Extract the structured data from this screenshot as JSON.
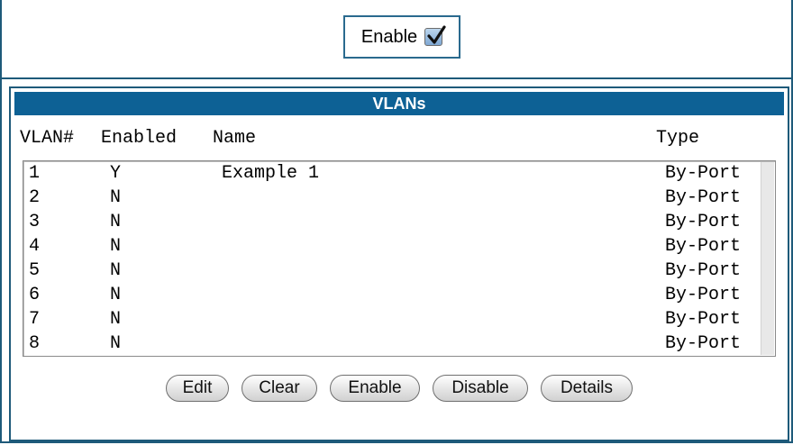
{
  "top": {
    "enable_label": "Enable",
    "enable_checked": true
  },
  "vlan_panel": {
    "title": "VLANs",
    "columns": {
      "vlan": "VLAN#",
      "enabled": "Enabled",
      "name": "Name",
      "type": "Type"
    },
    "rows": [
      {
        "vlan": "1",
        "enabled": "Y",
        "name": "Example 1",
        "type": "By-Port"
      },
      {
        "vlan": "2",
        "enabled": "N",
        "name": "",
        "type": "By-Port"
      },
      {
        "vlan": "3",
        "enabled": "N",
        "name": "",
        "type": "By-Port"
      },
      {
        "vlan": "4",
        "enabled": "N",
        "name": "",
        "type": "By-Port"
      },
      {
        "vlan": "5",
        "enabled": "N",
        "name": "",
        "type": "By-Port"
      },
      {
        "vlan": "6",
        "enabled": "N",
        "name": "",
        "type": "By-Port"
      },
      {
        "vlan": "7",
        "enabled": "N",
        "name": "",
        "type": "By-Port"
      },
      {
        "vlan": "8",
        "enabled": "N",
        "name": "",
        "type": "By-Port"
      }
    ],
    "buttons": {
      "edit": "Edit",
      "clear": "Clear",
      "enable": "Enable",
      "disable": "Disable",
      "details": "Details"
    }
  },
  "colors": {
    "header_bg": "#0d6195",
    "frame_border": "#1e5a7a"
  }
}
